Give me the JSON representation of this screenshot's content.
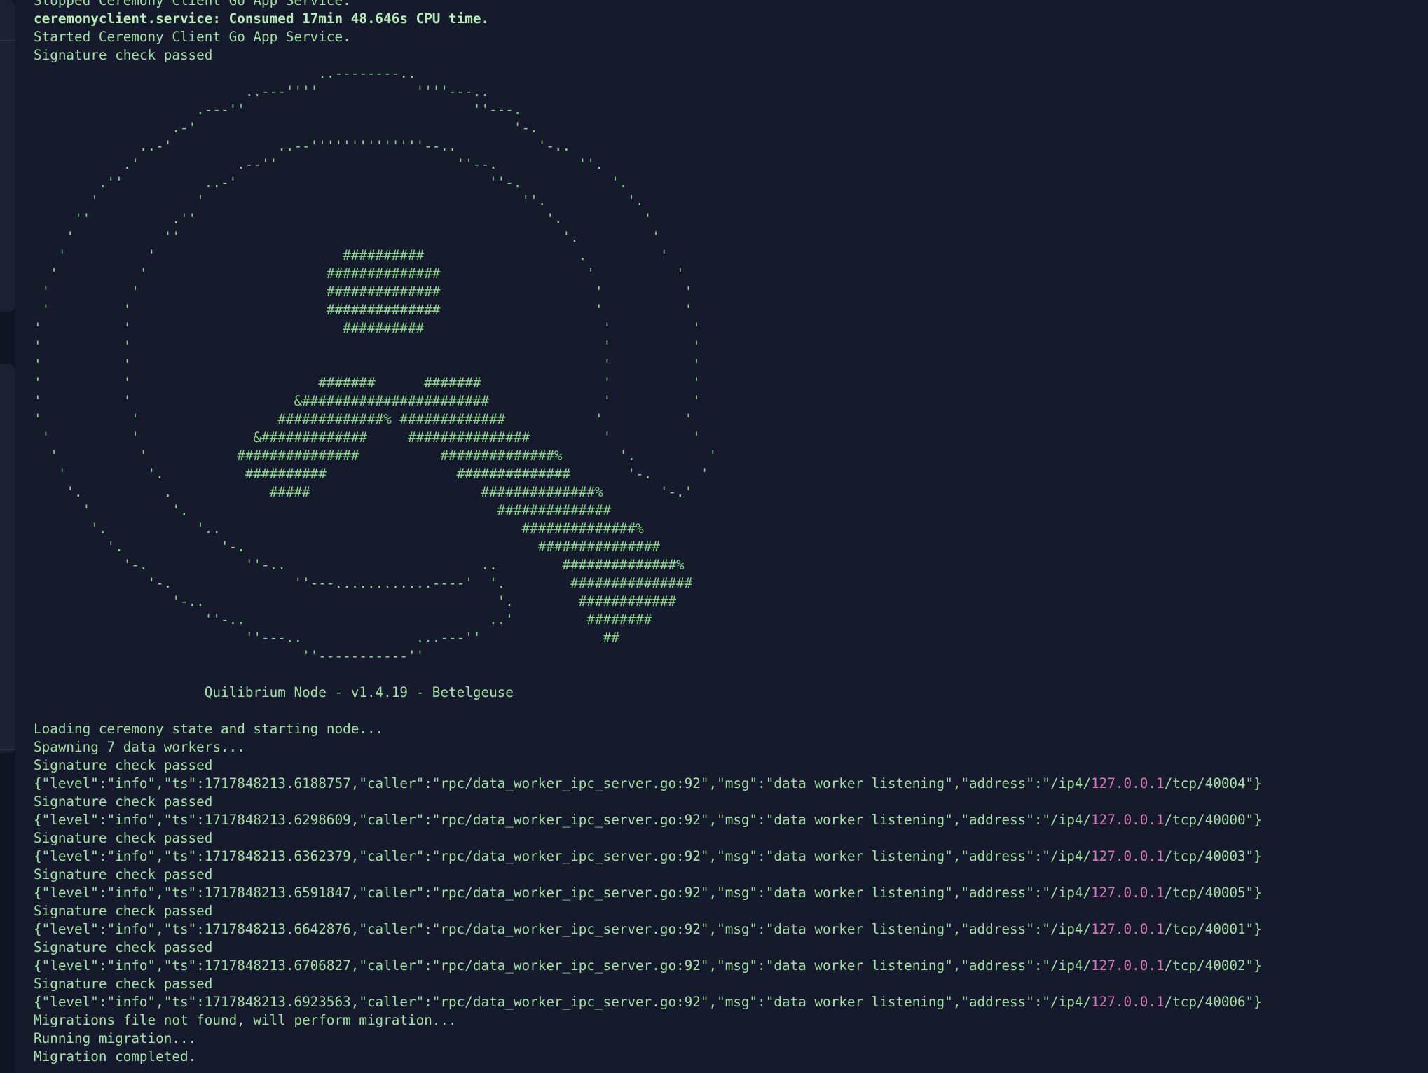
{
  "colors": {
    "background": "#151a2c",
    "text": "#a6dfa7",
    "ip_highlight": "#d779b7",
    "gutter": "#0f1322"
  },
  "header_lines": [
    "Stopped Ceremony Client Go App Service.",
    "ceremonyclient.service: Consumed 17min 48.646s CPU time.",
    "Started Ceremony Client Go App Service.",
    "Signature check passed"
  ],
  "ascii_art": [
    "                                   ..--------..",
    "                          ..---''''            ''''---..",
    "                    .---''                            ''---.",
    "                 .-'                                       '-.",
    "             ..-'             ..--''''''''''''''--..          '-..",
    "           .'            .--''                      ''--.          ''.",
    "        .''          ..-'                               ''-.           '.",
    "       '            '                                       ''.          '.",
    "     ''          .''                                           '.          '",
    "    '           ''                                               '.         '",
    "   '          '                       ##########                   .         '",
    "  '          '                      ##############                  '          '",
    " '          '                       ##############                   '          '",
    " '         '                        ##############                   '          '",
    "'          '                          ##########                      '          '",
    "'          '                                                          '          '",
    "'          '                                                          '          '",
    "'          '                       #######      #######               '          '",
    "'          '                    &#######################              '          '",
    "'           '                 #############% #############           '          '",
    " '          '              &#############     ###############         '          '",
    "  '          '           ###############          ##############%       '.         '",
    "   '          '.          ##########                ##############       '-.      '",
    "    '.          .            #####                     ##############%       '-.'",
    "      '          '.                                      ##############",
    "       '.           '..                                     ##############%",
    "         '.            '-.                                    ###############",
    "           '-.            ''-..                        ..        ##############%",
    "              '-.               ''---............----'  '.        ###############",
    "                 '-..                                    '.        ############",
    "                     ''-..                              ..'         ########",
    "                          ''---..              ...---''               ##",
    "                                 ''-----------''"
  ],
  "node_title": "                     Quilibrium Node - v1.4.19 - Betelgeuse",
  "startup_lines": [
    "Loading ceremony state and starting node...",
    "Spawning 7 data workers...",
    "Signature check passed"
  ],
  "worker_entries": [
    {
      "json_prefix": "{\"level\":\"info\",\"ts\":1717848213.6188757,\"caller\":\"rpc/data_worker_ipc_server.go:92\",\"msg\":\"data worker listening\",\"address\":\"/ip4/",
      "ip": "127.0.0.1",
      "json_suffix": "/tcp/40004\"}",
      "signature": "Signature check passed"
    },
    {
      "json_prefix": "{\"level\":\"info\",\"ts\":1717848213.6298609,\"caller\":\"rpc/data_worker_ipc_server.go:92\",\"msg\":\"data worker listening\",\"address\":\"/ip4/",
      "ip": "127.0.0.1",
      "json_suffix": "/tcp/40000\"}",
      "signature": "Signature check passed"
    },
    {
      "json_prefix": "{\"level\":\"info\",\"ts\":1717848213.6362379,\"caller\":\"rpc/data_worker_ipc_server.go:92\",\"msg\":\"data worker listening\",\"address\":\"/ip4/",
      "ip": "127.0.0.1",
      "json_suffix": "/tcp/40003\"}",
      "signature": "Signature check passed"
    },
    {
      "json_prefix": "{\"level\":\"info\",\"ts\":1717848213.6591847,\"caller\":\"rpc/data_worker_ipc_server.go:92\",\"msg\":\"data worker listening\",\"address\":\"/ip4/",
      "ip": "127.0.0.1",
      "json_suffix": "/tcp/40005\"}",
      "signature": "Signature check passed"
    },
    {
      "json_prefix": "{\"level\":\"info\",\"ts\":1717848213.6642876,\"caller\":\"rpc/data_worker_ipc_server.go:92\",\"msg\":\"data worker listening\",\"address\":\"/ip4/",
      "ip": "127.0.0.1",
      "json_suffix": "/tcp/40001\"}",
      "signature": "Signature check passed"
    },
    {
      "json_prefix": "{\"level\":\"info\",\"ts\":1717848213.6706827,\"caller\":\"rpc/data_worker_ipc_server.go:92\",\"msg\":\"data worker listening\",\"address\":\"/ip4/",
      "ip": "127.0.0.1",
      "json_suffix": "/tcp/40002\"}",
      "signature": "Signature check passed"
    },
    {
      "json_prefix": "{\"level\":\"info\",\"ts\":1717848213.6923563,\"caller\":\"rpc/data_worker_ipc_server.go:92\",\"msg\":\"data worker listening\",\"address\":\"/ip4/",
      "ip": "127.0.0.1",
      "json_suffix": "/tcp/40006\"}",
      "signature": null
    }
  ],
  "footer_lines": [
    "Migrations file not found, will perform migration...",
    "Running migration...",
    "Migration completed."
  ]
}
